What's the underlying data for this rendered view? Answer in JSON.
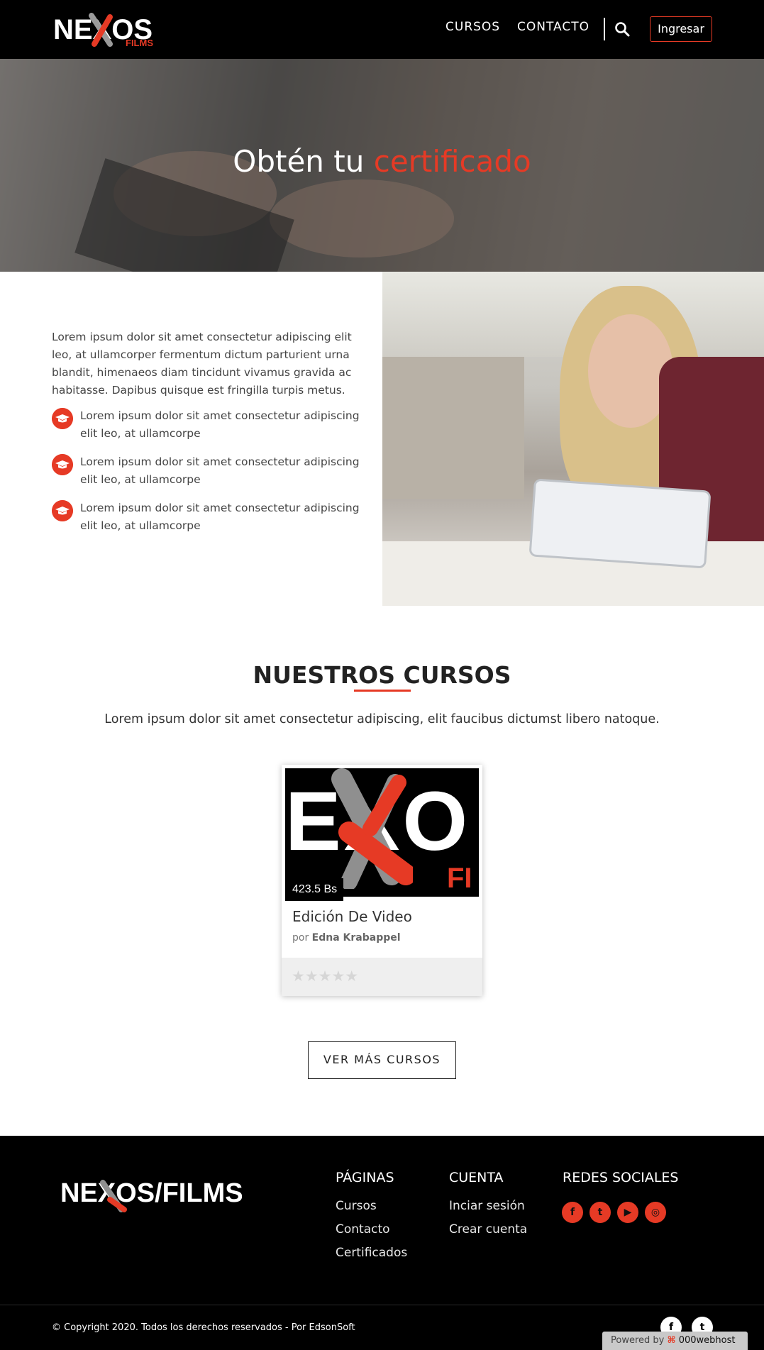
{
  "header": {
    "logo_word": "NEXOS",
    "logo_sub": "FILMS",
    "nav": [
      {
        "label": "CURSOS"
      },
      {
        "label": "CONTACTO"
      }
    ],
    "login_label": "Ingresar"
  },
  "hero": {
    "title_plain": "Obtén tu",
    "title_accent": "certificado"
  },
  "about": {
    "paragraph": "Lorem ipsum dolor sit amet consectetur adipiscing elit leo, at ullamcorper fermentum dictum parturient urna blandit, himenaeos diam tincidunt vivamus gravida ac habitasse. Dapibus quisque est fringilla turpis metus.",
    "items": [
      {
        "text": "Lorem ipsum dolor sit amet consectetur adipiscing elit leo, at ullamcorpe"
      },
      {
        "text": "Lorem ipsum dolor sit amet consectetur adipiscing elit leo, at ullamcorpe"
      },
      {
        "text": "Lorem ipsum dolor sit amet consectetur adipiscing elit leo, at ullamcorpe"
      }
    ]
  },
  "courses": {
    "title": "NUESTROS CURSOS",
    "subtitle": "Lorem ipsum dolor sit amet consectetur adipiscing, elit faucibus dictumst libero natoque.",
    "card": {
      "price": "423.5 Bs",
      "title": "Edición De Video",
      "author_prefix": "por",
      "author": "Edna Krabappel",
      "stars": "★★★★★",
      "image_text": "EXO",
      "image_sub": "FI"
    },
    "more_label": "VER MÁS CURSOS"
  },
  "footer": {
    "logo": "NEXOS/FILMS",
    "columns": [
      {
        "heading": "PÁGINAS",
        "links": [
          "Cursos",
          "Contacto",
          "Certificados"
        ]
      },
      {
        "heading": "CUENTA",
        "links": [
          "Inciar sesión",
          "Crear cuenta"
        ]
      },
      {
        "heading": "REDES SOCIALES",
        "links": []
      }
    ],
    "social_icons": [
      "facebook-icon",
      "twitter-icon",
      "youtube-icon",
      "instagram-icon"
    ],
    "copyright": "© Copyright 2020. Todos los derechos reservados - Por EdsonSoft",
    "powered_prefix": "Powered by",
    "powered_brand": "000webhost"
  },
  "colors": {
    "accent": "#e63a25",
    "header_bg": "#000000",
    "footer_bg": "#000000"
  }
}
